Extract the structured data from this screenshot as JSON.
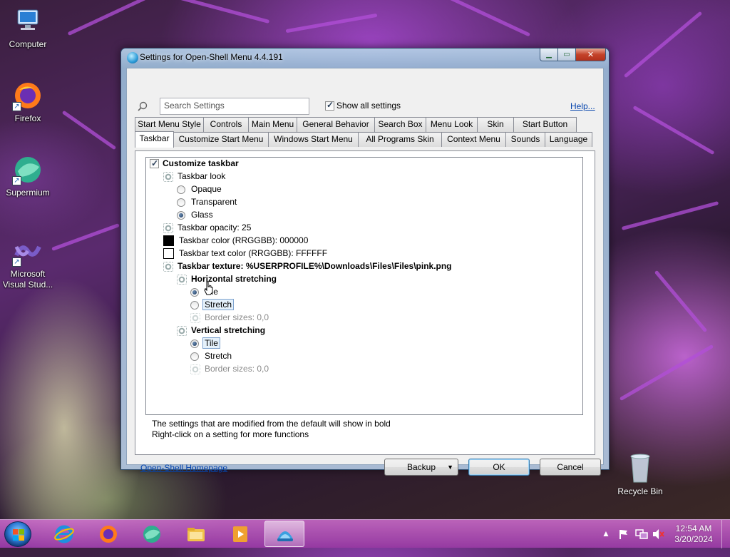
{
  "desktop": {
    "icons": [
      {
        "label": "Computer"
      },
      {
        "label": "Firefox"
      },
      {
        "label": "Supermium"
      },
      {
        "label": "Microsoft Visual Stud..."
      },
      {
        "label": "Recycle Bin"
      }
    ]
  },
  "window": {
    "title": "Settings for Open-Shell Menu 4.4.191",
    "search_placeholder": "Search Settings",
    "show_all_label": "Show all settings",
    "show_all_checked": true,
    "help_link": "Help...",
    "tabs_row1": [
      "Start Menu Style",
      "Controls",
      "Main Menu",
      "General Behavior",
      "Search Box",
      "Menu Look",
      "Skin",
      "Start Button"
    ],
    "tabs_row2": [
      "Taskbar",
      "Customize Start Menu",
      "Windows Start Menu",
      "All Programs Skin",
      "Context Menu",
      "Sounds",
      "Language"
    ],
    "active_tab": "Taskbar",
    "settings": {
      "customize_taskbar": "Customize taskbar",
      "taskbar_look": "Taskbar look",
      "opaque": "Opaque",
      "transparent": "Transparent",
      "glass": "Glass",
      "taskbar_opacity": "Taskbar opacity: 25",
      "taskbar_color": "Taskbar color (RRGGBB): 000000",
      "taskbar_text_color": "Taskbar text color (RRGGBB): FFFFFF",
      "taskbar_texture": "Taskbar texture: %USERPROFILE%\\Downloads\\Files\\Files\\pink.png",
      "horizontal_stretching": "Horizontal stretching",
      "h_tile": "Tile",
      "h_stretch": "Stretch",
      "h_border_sizes": "Border sizes: 0,0",
      "vertical_stretching": "Vertical stretching",
      "v_tile": "Tile",
      "v_stretch": "Stretch",
      "v_border_sizes": "Border sizes: 0,0",
      "colors": {
        "taskbar_color": "#000000",
        "taskbar_text_color": "#FFFFFF"
      }
    },
    "notes": [
      "The settings that are modified from the default will show in bold",
      "Right-click on a setting for more functions"
    ],
    "homepage_link": "Open-Shell Homepage",
    "buttons": {
      "backup": "Backup",
      "ok": "OK",
      "cancel": "Cancel"
    }
  },
  "taskbar": {
    "pinned": [
      "internet-explorer-icon",
      "firefox-icon",
      "supermium-icon",
      "file-explorer-icon",
      "media-player-icon",
      "open-shell-icon"
    ],
    "clock_time": "12:54 AM",
    "clock_date": "3/20/2024"
  }
}
